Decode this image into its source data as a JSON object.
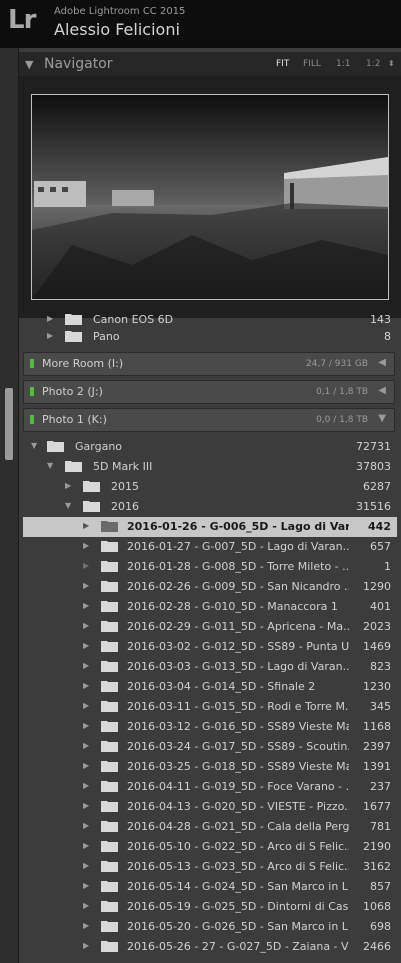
{
  "app": {
    "logo": "Lr",
    "name": "Adobe Lightroom CC 2015",
    "user": "Alessio Felicioni"
  },
  "navigator": {
    "title": "Navigator",
    "zoom_options": [
      "FIT",
      "FILL",
      "1:1",
      "1:2"
    ],
    "zoom_arrow": "⬍"
  },
  "folders_top": [
    {
      "name": "Canon EOS 6D",
      "count": "143"
    },
    {
      "name": "Pano",
      "count": "8"
    }
  ],
  "volumes": [
    {
      "name": "More Room (I:)",
      "size": "24,7 / 931 GB",
      "arrow": "◀"
    },
    {
      "name": "Photo 2 (J:)",
      "size": "0,1 / 1,8 TB",
      "arrow": "◀"
    },
    {
      "name": "Photo 1 (K:)",
      "size": "0,0 / 1,8 TB",
      "arrow": "▼"
    }
  ],
  "tree": [
    {
      "name": "Gargano",
      "count": "72731"
    },
    {
      "name": "5D Mark III",
      "count": "37803"
    },
    {
      "name": "2015",
      "count": "6287"
    },
    {
      "name": "2016",
      "count": "31516"
    }
  ],
  "subfolders": [
    {
      "name": "2016-01-26 - G-006_5D - Lago di Varan...",
      "count": "442",
      "selected": true
    },
    {
      "name": "2016-01-27 - G-007_5D - Lago di Varan...",
      "count": "657"
    },
    {
      "name": "2016-01-28 - G-008_5D - Torre Mileto - ...",
      "count": "1"
    },
    {
      "name": "2016-02-26 - G-009_5D - San Nicandro ...",
      "count": "1290"
    },
    {
      "name": "2016-02-28 - G-010_5D - Manaccora 1",
      "count": "401"
    },
    {
      "name": "2016-02-29 - G-011_5D - Apricena - Ma...",
      "count": "2023"
    },
    {
      "name": "2016-03-02 - G-012_5D - SS89 - Punta U...",
      "count": "1469"
    },
    {
      "name": "2016-03-03 - G-013_5D - Lago di Varan...",
      "count": "823"
    },
    {
      "name": "2016-03-04 - G-014_5D - Sfinale 2",
      "count": "1230"
    },
    {
      "name": "2016-03-11 - G-015_5D - Rodi e Torre M...",
      "count": "345"
    },
    {
      "name": "2016-03-12 - G-016_5D - SS89 Vieste Ma...",
      "count": "1168"
    },
    {
      "name": "2016-03-24 - G-017_5D - SS89 - Scoutin...",
      "count": "2397"
    },
    {
      "name": "2016-03-25 - G-018_5D - SS89 Vieste Ma...",
      "count": "1391"
    },
    {
      "name": "2016-04-11 - G-019_5D - Foce Varano - ...",
      "count": "237"
    },
    {
      "name": "2016-04-13 - G-020_5D - VIESTE - Pizzo...",
      "count": "1677"
    },
    {
      "name": "2016-04-28 - G-021_5D - Cala della Perg...",
      "count": "781"
    },
    {
      "name": "2016-05-10 - G-022_5D - Arco di S Felic...",
      "count": "2190"
    },
    {
      "name": "2016-05-13 - G-023_5D - Arco di S Felic...",
      "count": "3162"
    },
    {
      "name": "2016-05-14 - G-024_5D - San Marco in L...",
      "count": "857"
    },
    {
      "name": "2016-05-19 - G-025_5D - Dintorni di Cas...",
      "count": "1068"
    },
    {
      "name": "2016-05-20 - G-026_5D - San Marco in L...",
      "count": "698"
    },
    {
      "name": "2016-05-26 - 27 - G-027_5D - Zaiana - Vi...",
      "count": "2466"
    }
  ]
}
